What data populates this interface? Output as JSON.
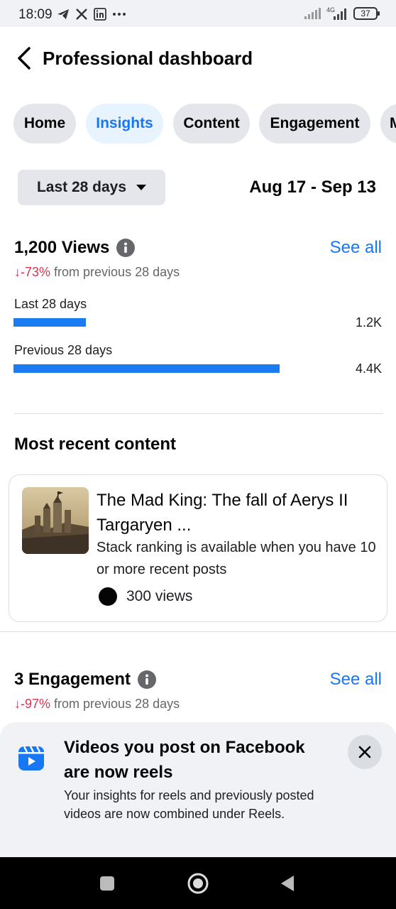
{
  "status_bar": {
    "time": "18:09",
    "left_icons": [
      "telegram-icon",
      "x-icon",
      "linkedin-icon",
      "more-dots-icon"
    ],
    "network": "4G",
    "battery": "37"
  },
  "header": {
    "title": "Professional dashboard"
  },
  "tabs": [
    {
      "label": "Home",
      "active": false
    },
    {
      "label": "Insights",
      "active": true
    },
    {
      "label": "Content",
      "active": false
    },
    {
      "label": "Engagement",
      "active": false
    },
    {
      "label": "M",
      "active": false
    }
  ],
  "date_filter": {
    "selected": "Last 28 days",
    "range": "Aug 17 - Sep 13"
  },
  "views": {
    "title": "1,200 Views",
    "see_all": "See all",
    "delta_value": "↓-73%",
    "delta_text": " from previous 28 days",
    "bars": [
      {
        "label": "Last 28 days",
        "value_text": "1.2K",
        "value": 1200
      },
      {
        "label": "Previous 28 days",
        "value_text": "4.4K",
        "value": 4400
      }
    ]
  },
  "recent": {
    "heading": "Most recent content",
    "item": {
      "title_line1": "The Mad King: The fall of Aerys II",
      "title_line2": "Targaryen ...",
      "subtitle": "Stack ranking is available when you have 10 or more recent posts",
      "views": "300 views"
    }
  },
  "engagement": {
    "title": "3 Engagement",
    "see_all": "See all",
    "delta_value": "↓-97%",
    "delta_text": " from previous 28 days"
  },
  "banner": {
    "title": "Videos you post on Facebook are now reels",
    "body": "Your insights for reels and previously posted videos are now combined under Reels."
  },
  "colors": {
    "accent": "#1877f2",
    "bar": "#1b7bf0",
    "negative": "#d93651",
    "chip": "#e4e6eb",
    "chip_active_bg": "#e7f3ff"
  }
}
